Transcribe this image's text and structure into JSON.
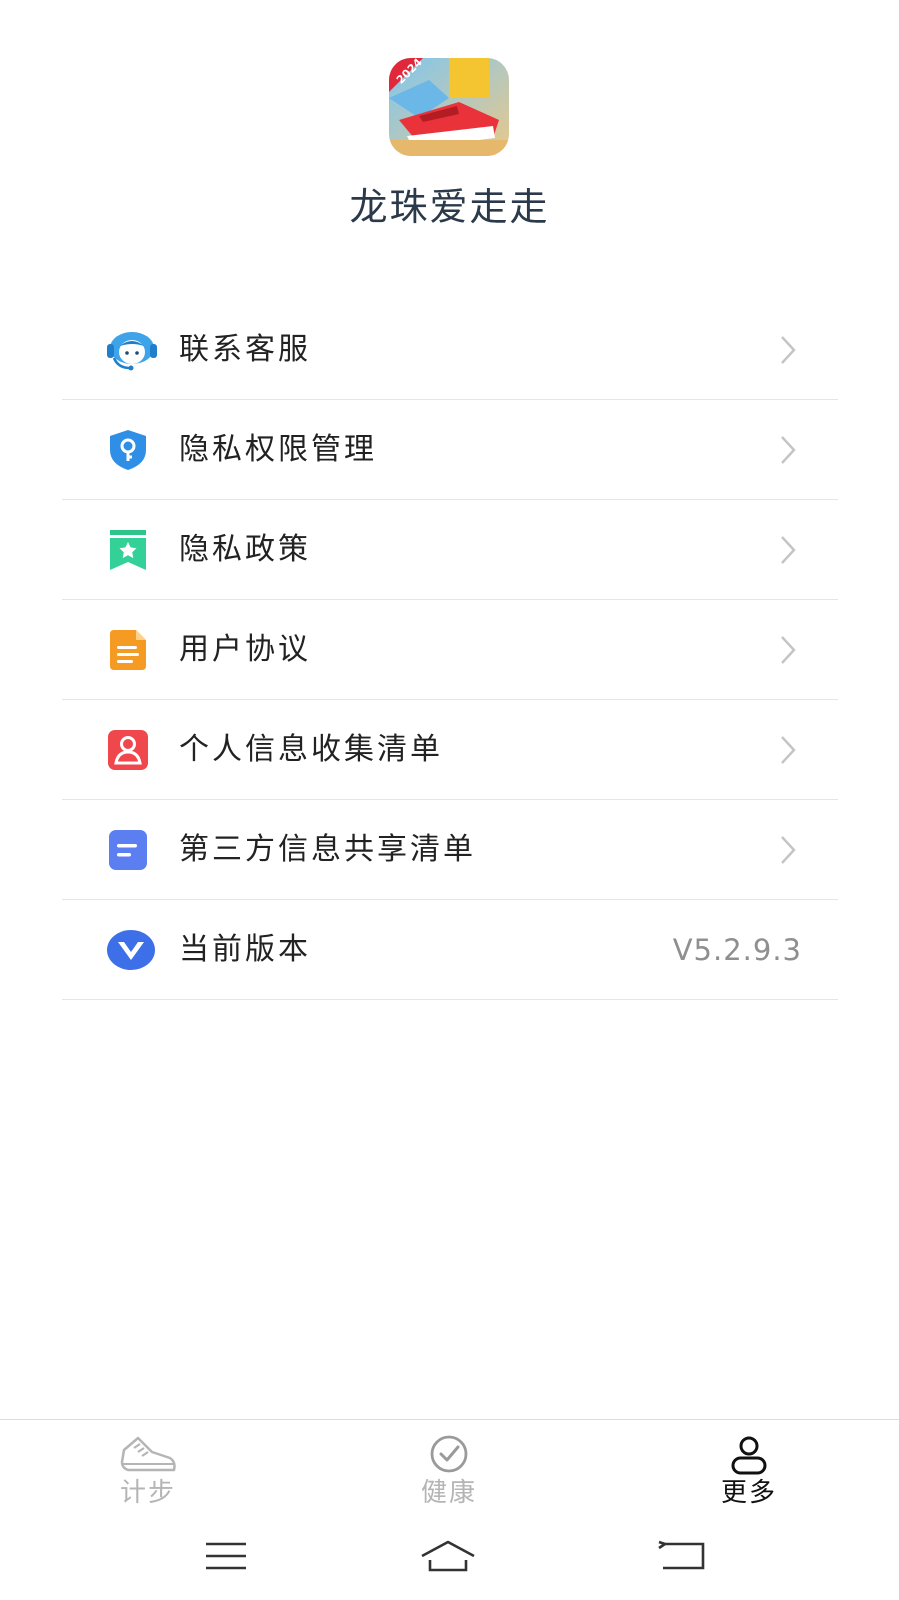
{
  "app": {
    "name": "龙珠爱走走",
    "icon": "app-logo-sneaker-icon",
    "icon_badge": "2024"
  },
  "menu": {
    "items": [
      {
        "label": "联系客服",
        "icon": "customer-service-icon",
        "accessory": "chevron"
      },
      {
        "label": "隐私权限管理",
        "icon": "shield-key-icon",
        "accessory": "chevron"
      },
      {
        "label": "隐私政策",
        "icon": "bookmark-star-icon",
        "accessory": "chevron"
      },
      {
        "label": "用户协议",
        "icon": "document-icon",
        "accessory": "chevron"
      },
      {
        "label": "个人信息收集清单",
        "icon": "user-badge-icon",
        "accessory": "chevron"
      },
      {
        "label": "第三方信息共享清单",
        "icon": "note-icon",
        "accessory": "chevron"
      },
      {
        "label": "当前版本",
        "icon": "version-v-icon",
        "value": "V5.2.9.3"
      }
    ]
  },
  "tabbar": {
    "tabs": [
      {
        "label": "计步",
        "icon": "sneaker-icon",
        "active": false
      },
      {
        "label": "健康",
        "icon": "heart-check-icon",
        "active": false
      },
      {
        "label": "更多",
        "icon": "user-icon",
        "active": true
      }
    ]
  },
  "colors": {
    "title": "#2b3a4a",
    "text": "#222222",
    "muted": "#8f8f8f",
    "divider": "#e6e6e6",
    "inactive_tab": "#b5b5b5",
    "active_tab": "#111111"
  }
}
